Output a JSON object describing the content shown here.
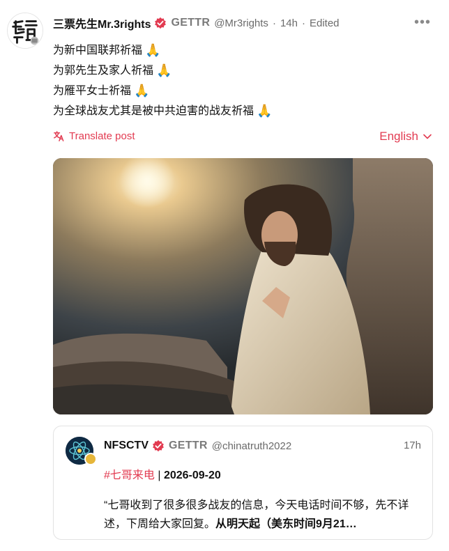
{
  "post": {
    "display_name": "三票先生Mr.3rights",
    "platform_tag": "GETTR",
    "handle": "@Mr3rights",
    "separator": "·",
    "time": "14h",
    "edited": "Edited",
    "more": "•••",
    "lines": [
      "为新中国联邦祈福",
      "为郭先生及家人祈福",
      "为雁平女士祈福",
      "为全球战友尤其是被中共迫害的战友祈福"
    ],
    "pray_emoji": "🙏",
    "translate_label": "Translate post",
    "language": "English"
  },
  "quote": {
    "display_name": "NFSCTV",
    "platform_tag": "GETTR",
    "handle": "@chinatruth2022",
    "time": "17h",
    "hashtag": "#七哥来电",
    "divider": " | ",
    "date": "2026-09-20",
    "body_regular": "“七哥收到了很多很多战友的信息，今天电话时间不够，先不详述，下周给大家回复。",
    "body_bold": "从明天起（美东时间9月21…"
  },
  "colors": {
    "accent": "#e23b51",
    "muted": "#6b6b6b",
    "text": "#111111"
  },
  "icons": {
    "verified": "verified-badge-icon",
    "translate": "translate-icon",
    "chevron": "chevron-down-icon",
    "more": "more-horizontal-icon"
  }
}
